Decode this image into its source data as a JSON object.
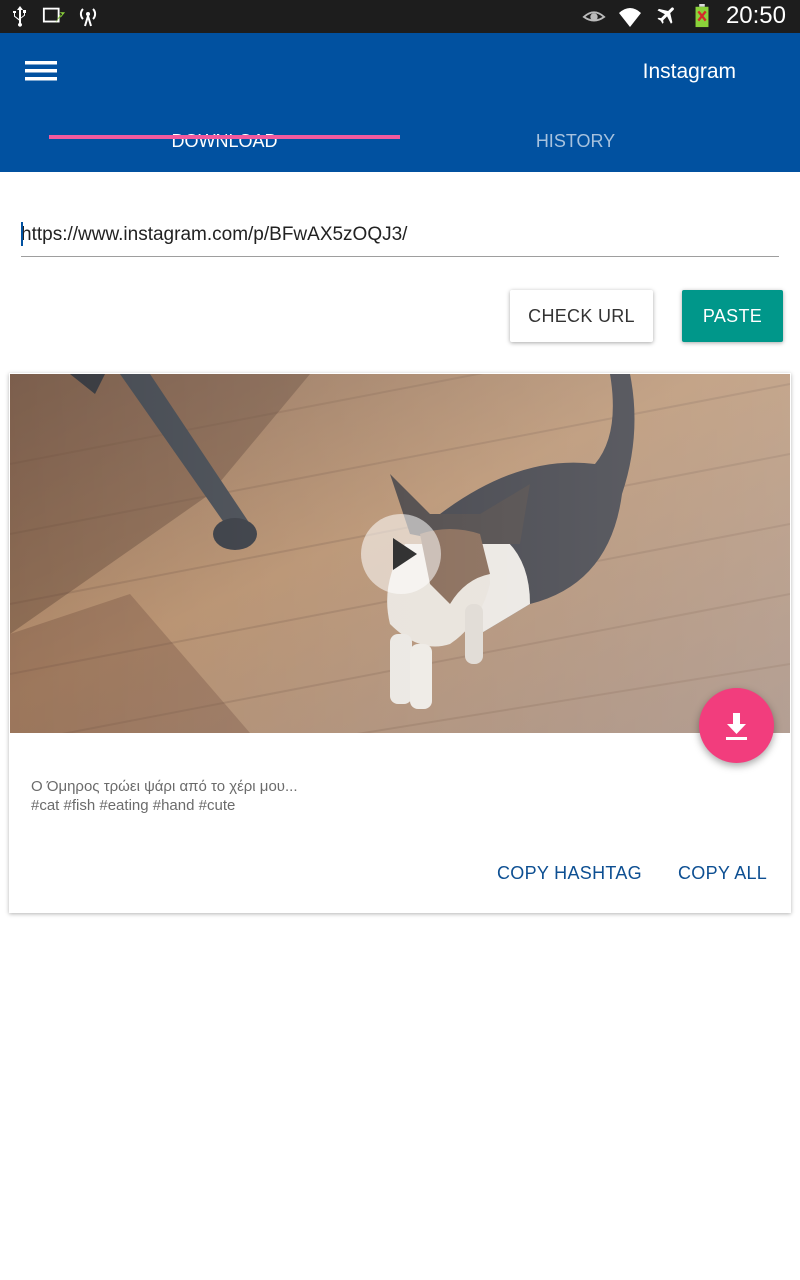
{
  "status_bar": {
    "time": "20:50",
    "icons": [
      "usb-icon",
      "screen-mirror-icon",
      "signal-broadcast-icon",
      "eye-icon",
      "wifi-icon",
      "airplane-icon",
      "battery-icon"
    ]
  },
  "app_bar": {
    "title": "Instagram",
    "menu_icon": "hamburger-menu-icon",
    "tabs": [
      {
        "label": "DOWNLOAD",
        "active": true
      },
      {
        "label": "HISTORY",
        "active": false
      }
    ],
    "accent_color": "#0151a0",
    "indicator_color": "#f25a9e"
  },
  "url_input": {
    "value": "https://www.instagram.com/p/BFwAX5zOQJ3/"
  },
  "actions": {
    "check_url_label": "CHECK URL",
    "paste_label": "PASTE",
    "paste_color": "#00978a"
  },
  "post": {
    "media_icon": "play-icon",
    "caption_line1": "Ο Όμηρος τρώει ψάρι από το χέρι μου...",
    "caption_line2": "#cat #fish #eating #hand #cute",
    "copy_hashtag_label": "COPY HASHTAG",
    "copy_all_label": "COPY ALL",
    "download_icon": "download-icon",
    "fab_color": "#f23d7d"
  }
}
